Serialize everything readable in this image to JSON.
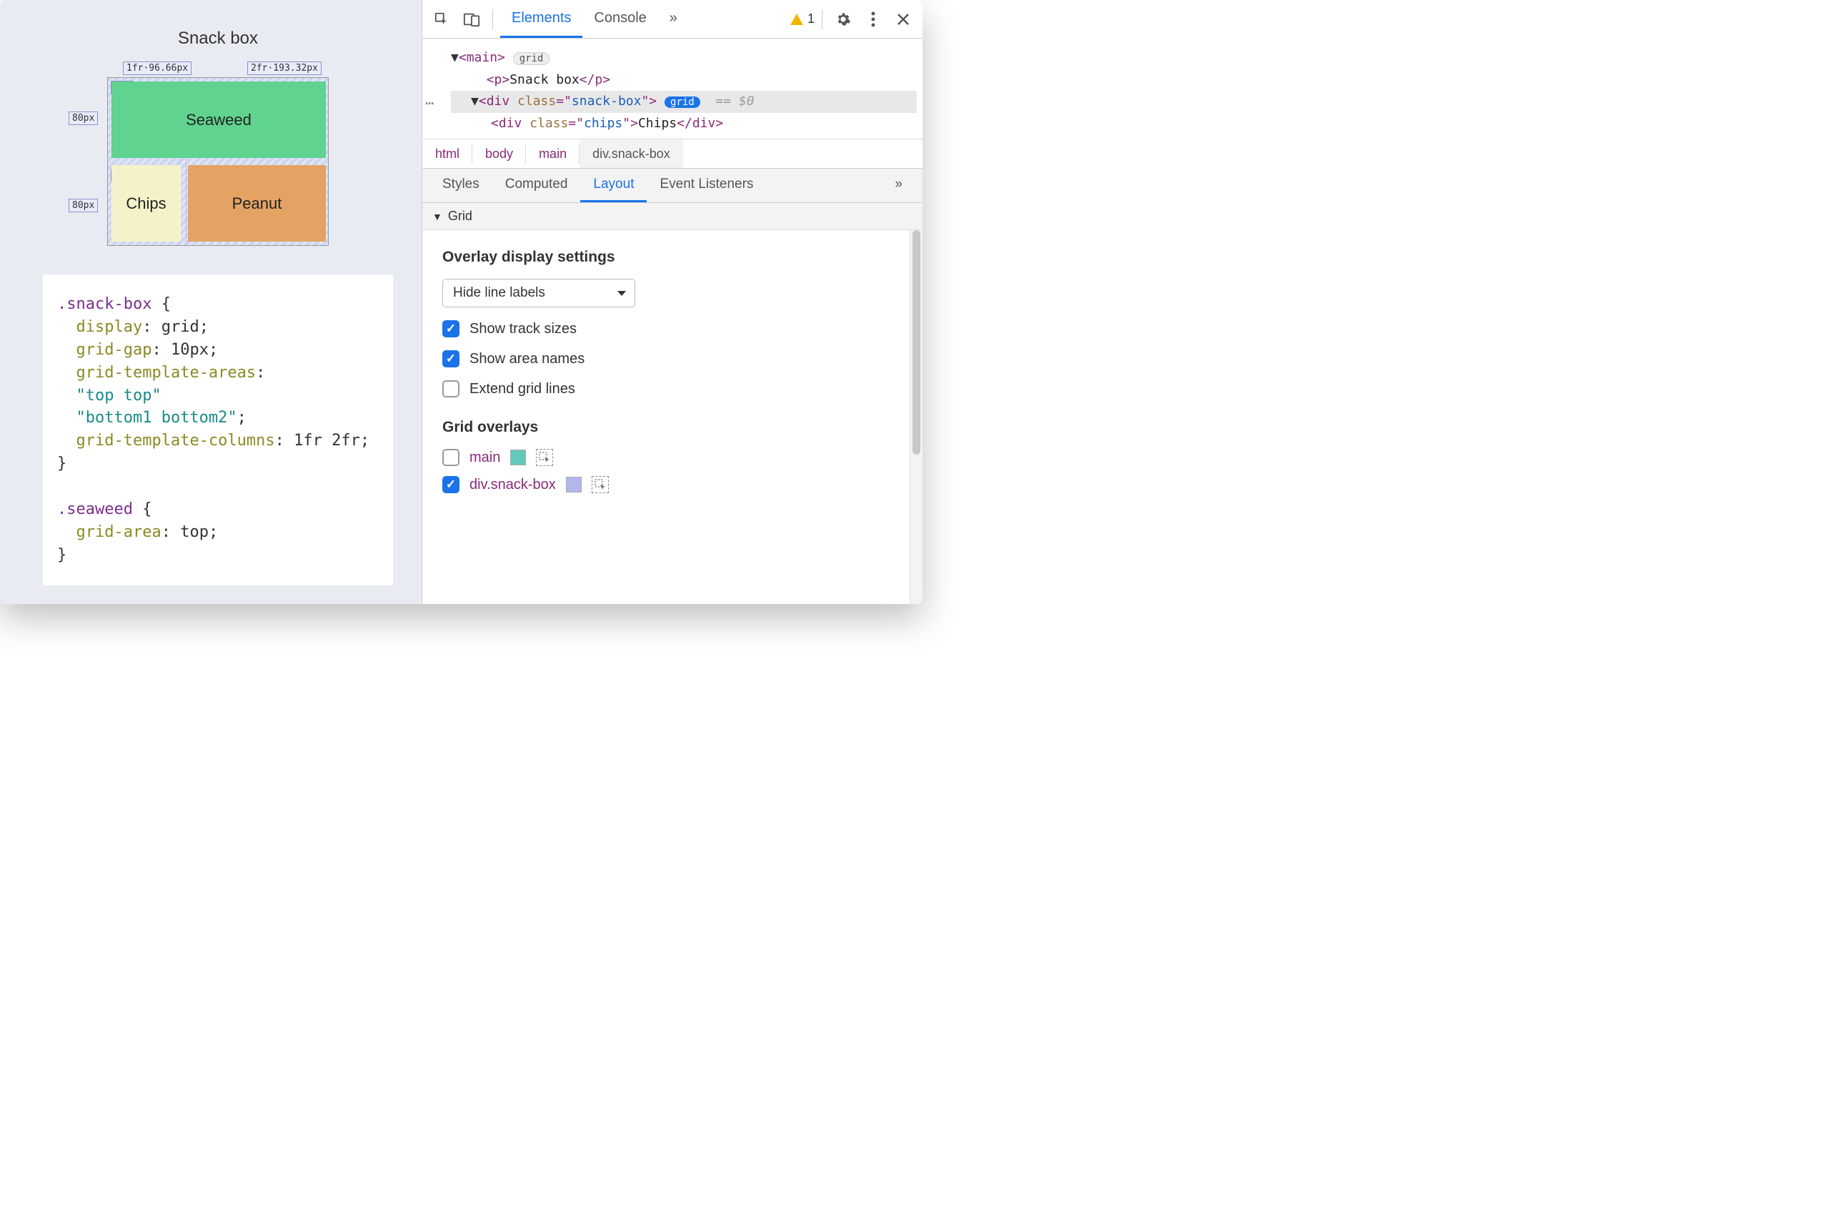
{
  "page": {
    "title": "Snack box"
  },
  "grid": {
    "row_label": "80px",
    "col_labels": [
      "1fr·96.66px",
      "2fr·193.32px"
    ],
    "areas": {
      "top": "top",
      "bottom1": "bottom1",
      "bottom2": "bottom2"
    },
    "cells": {
      "seaweed": "Seaweed",
      "chips": "Chips",
      "peanut": "Peanut"
    }
  },
  "code": {
    "sel1": ".snack-box",
    "rules1": [
      {
        "p": "display",
        "v": "grid"
      },
      {
        "p": "grid-gap",
        "v": "10px"
      },
      {
        "p": "grid-template-areas",
        "v": null
      },
      {
        "str1": "\"top top\""
      },
      {
        "str2": "\"bottom1 bottom2\""
      },
      {
        "p": "grid-template-columns",
        "v": "1fr 2fr"
      }
    ],
    "sel2": ".seaweed",
    "rules2": [
      {
        "p": "grid-area",
        "v": "top"
      }
    ]
  },
  "devtools": {
    "toolbar": {
      "tabs": [
        "Elements",
        "Console"
      ],
      "more": "»",
      "warning_count": "1"
    },
    "dom": {
      "line1": {
        "tag": "main",
        "badge": "grid"
      },
      "line2": {
        "tag": "p",
        "text": "Snack box"
      },
      "line3": {
        "tag": "div",
        "class": "snack-box",
        "badge": "grid",
        "eq": "== $0"
      },
      "line4": {
        "tag": "div",
        "class": "chips",
        "text": "Chips"
      }
    },
    "breadcrumb": [
      "html",
      "body",
      "main",
      "div.snack-box"
    ],
    "subtabs": [
      "Styles",
      "Computed",
      "Layout",
      "Event Listeners"
    ],
    "subtabs_more": "»",
    "layout": {
      "section": "Grid",
      "overlay_heading": "Overlay display settings",
      "dropdown": "Hide line labels",
      "options": {
        "track_sizes": {
          "label": "Show track sizes",
          "checked": true
        },
        "area_names": {
          "label": "Show area names",
          "checked": true
        },
        "extend": {
          "label": "Extend grid lines",
          "checked": false
        }
      },
      "grid_overlays_heading": "Grid overlays",
      "overlays": [
        {
          "label": "main",
          "checked": false,
          "color": "#63c9b8"
        },
        {
          "label": "div.snack-box",
          "checked": true,
          "color": "#b1b6ec"
        }
      ]
    }
  }
}
